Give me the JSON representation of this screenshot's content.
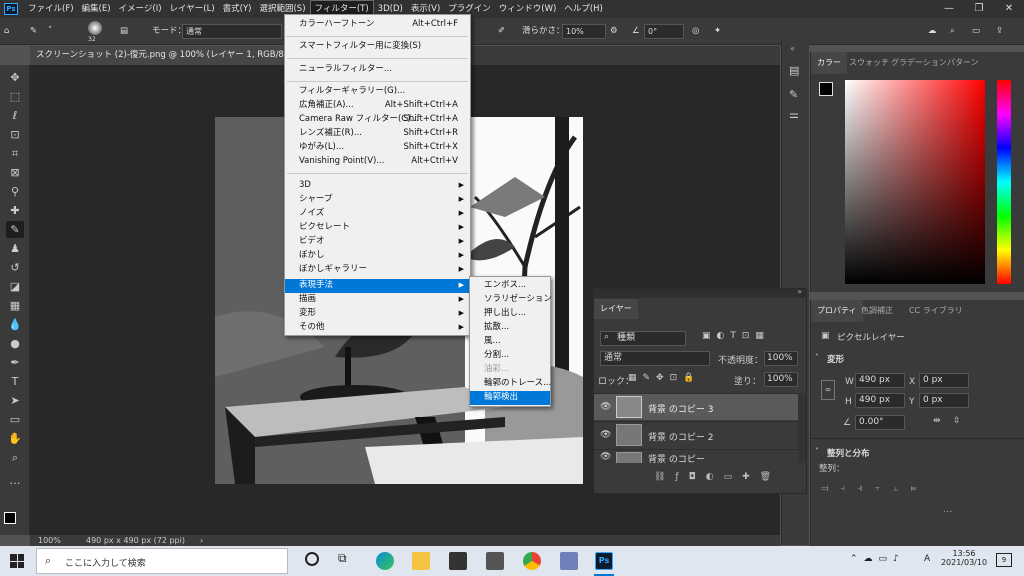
{
  "menubar": {
    "items": [
      "ファイル(F)",
      "編集(E)",
      "イメージ(I)",
      "レイヤー(L)",
      "書式(Y)",
      "選択範囲(S)",
      "フィルター(T)",
      "3D(D)",
      "表示(V)",
      "プラグイン",
      "ウィンドウ(W)",
      "ヘルプ(H)"
    ],
    "logo": "Ps"
  },
  "optbar": {
    "brush_size": "32",
    "mode_label": "モード：",
    "mode_value": "通常",
    "smoothing_label": "滑らかさ：",
    "smoothing_value": "10%",
    "angle_value": "0°"
  },
  "tabs": {
    "doc1": "スクリーンショット (2)-復元.png @ 100% (レイヤー 1, RGB/8) *",
    "doc1_close": "×"
  },
  "filter_menu": {
    "items": [
      {
        "label": "カラーハーフトーン",
        "shortcut": "Alt+Ctrl+F"
      },
      {
        "label": "スマートフィルター用に変換(S)",
        "shortcut": ""
      },
      {
        "label": "ニューラルフィルター...",
        "shortcut": ""
      },
      {
        "label": "フィルターギャラリー(G)...",
        "shortcut": ""
      },
      {
        "label": "広角補正(A)...",
        "shortcut": "Alt+Shift+Ctrl+A"
      },
      {
        "label": "Camera Raw フィルター(C)...",
        "shortcut": "Shift+Ctrl+A"
      },
      {
        "label": "レンズ補正(R)...",
        "shortcut": "Shift+Ctrl+R"
      },
      {
        "label": "ゆがみ(L)...",
        "shortcut": "Shift+Ctrl+X"
      },
      {
        "label": "Vanishing Point(V)...",
        "shortcut": "Alt+Ctrl+V"
      },
      {
        "label": "3D",
        "shortcut": ""
      },
      {
        "label": "シャープ",
        "shortcut": ""
      },
      {
        "label": "ノイズ",
        "shortcut": ""
      },
      {
        "label": "ピクセレート",
        "shortcut": ""
      },
      {
        "label": "ビデオ",
        "shortcut": ""
      },
      {
        "label": "ぼかし",
        "shortcut": ""
      },
      {
        "label": "ぼかしギャラリー",
        "shortcut": ""
      },
      {
        "label": "表現手法",
        "shortcut": ""
      },
      {
        "label": "描画",
        "shortcut": ""
      },
      {
        "label": "変形",
        "shortcut": ""
      },
      {
        "label": "その他",
        "shortcut": ""
      }
    ]
  },
  "stylize_menu": {
    "items": [
      "エンボス...",
      "ソラリゼーション",
      "押し出し...",
      "拡散...",
      "風...",
      "分割...",
      "油彩...",
      "輪郭のトレース...",
      "輪郭検出"
    ]
  },
  "color_panel": {
    "tabs": [
      "カラー",
      "スウォッチ",
      "グラデーション",
      "パターン"
    ]
  },
  "props_panel": {
    "tabs": [
      "プロパティ",
      "色調補正",
      "CC ライブラリ"
    ],
    "layer_type": "ピクセルレイヤー",
    "transform_title": "変形",
    "w_label": "W",
    "w_value": "490 px",
    "h_label": "H",
    "h_value": "490 px",
    "x_label": "X",
    "x_value": "0 px",
    "y_label": "Y",
    "y_value": "0 px",
    "angle_value": "0.00°",
    "align_title": "整列と分布",
    "align_label": "整列："
  },
  "layers_panel": {
    "tab": "レイヤー",
    "filter_kind": "種類",
    "blend_mode": "通常",
    "opacity_label": "不透明度：",
    "opacity_value": "100%",
    "lock_label": "ロック：",
    "fill_label": "塗り：",
    "fill_value": "100%",
    "layers": [
      "背景 のコピー 3",
      "背景 のコピー 2",
      "背景 のコピー"
    ]
  },
  "status": {
    "zoom": "100%",
    "size": "490 px x 490 px (72 ppi)"
  },
  "taskbar": {
    "search_placeholder": "ここに入力して検索",
    "time": "13:56",
    "date": "2021/03/10",
    "ime": "A",
    "notif": "9"
  },
  "colors": {
    "accent": "#0078d7",
    "bg": "#535353",
    "panel": "#3a3a3a"
  }
}
